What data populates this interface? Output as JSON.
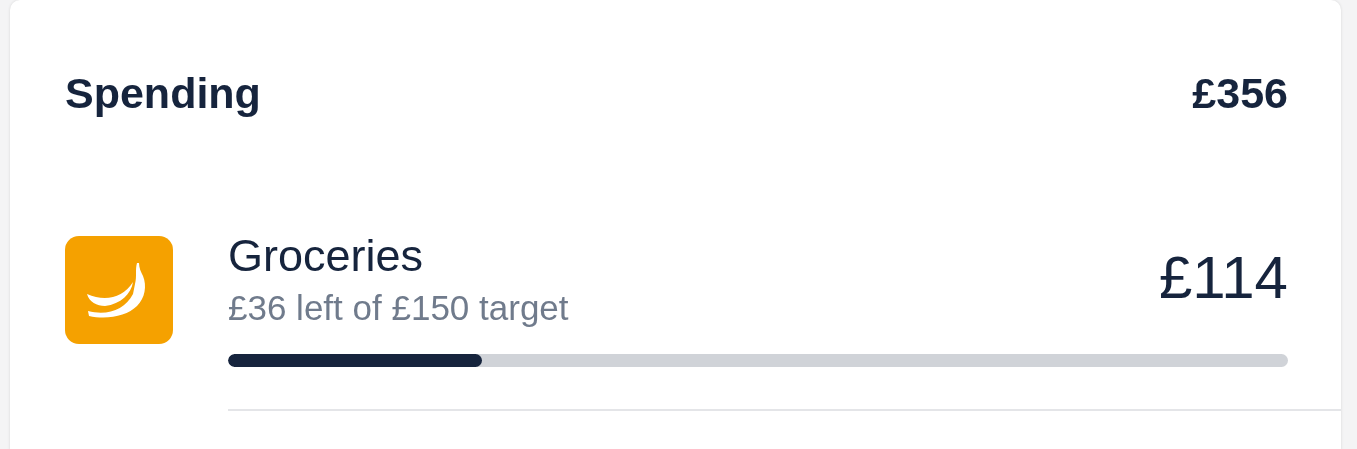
{
  "card": {
    "title": "Spending",
    "total": "£356",
    "items": [
      {
        "kind": "groceries",
        "name": "Groceries",
        "subtitle": "£36 left of £150 target",
        "amount": "£114",
        "level": 0.24,
        "color": "#f5a100"
      }
    ]
  }
}
